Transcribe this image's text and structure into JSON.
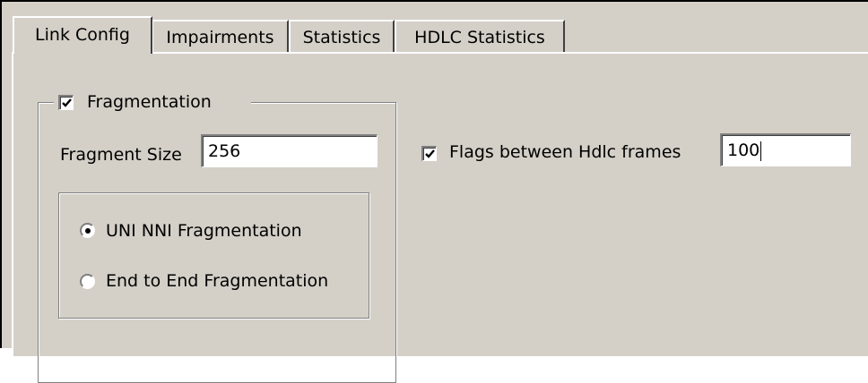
{
  "tabs": [
    {
      "label": "Link Config",
      "active": true
    },
    {
      "label": "Impairments",
      "active": false
    },
    {
      "label": "Statistics",
      "active": false
    },
    {
      "label": "HDLC Statistics",
      "active": false
    }
  ],
  "fragmentation": {
    "label": "Fragmentation",
    "checked": true,
    "fragment_size_label": "Fragment Size",
    "fragment_size_value": "256",
    "options": [
      {
        "label": "UNI NNI Fragmentation",
        "selected": true
      },
      {
        "label": "End to End Fragmentation",
        "selected": false
      }
    ]
  },
  "flags": {
    "label": "Flags between Hdlc frames",
    "checked": true,
    "value": "100"
  },
  "colors": {
    "face": "#d4d0c8",
    "highlight": "#ffffff",
    "shadow": "#808080",
    "dark_shadow": "#404040"
  }
}
